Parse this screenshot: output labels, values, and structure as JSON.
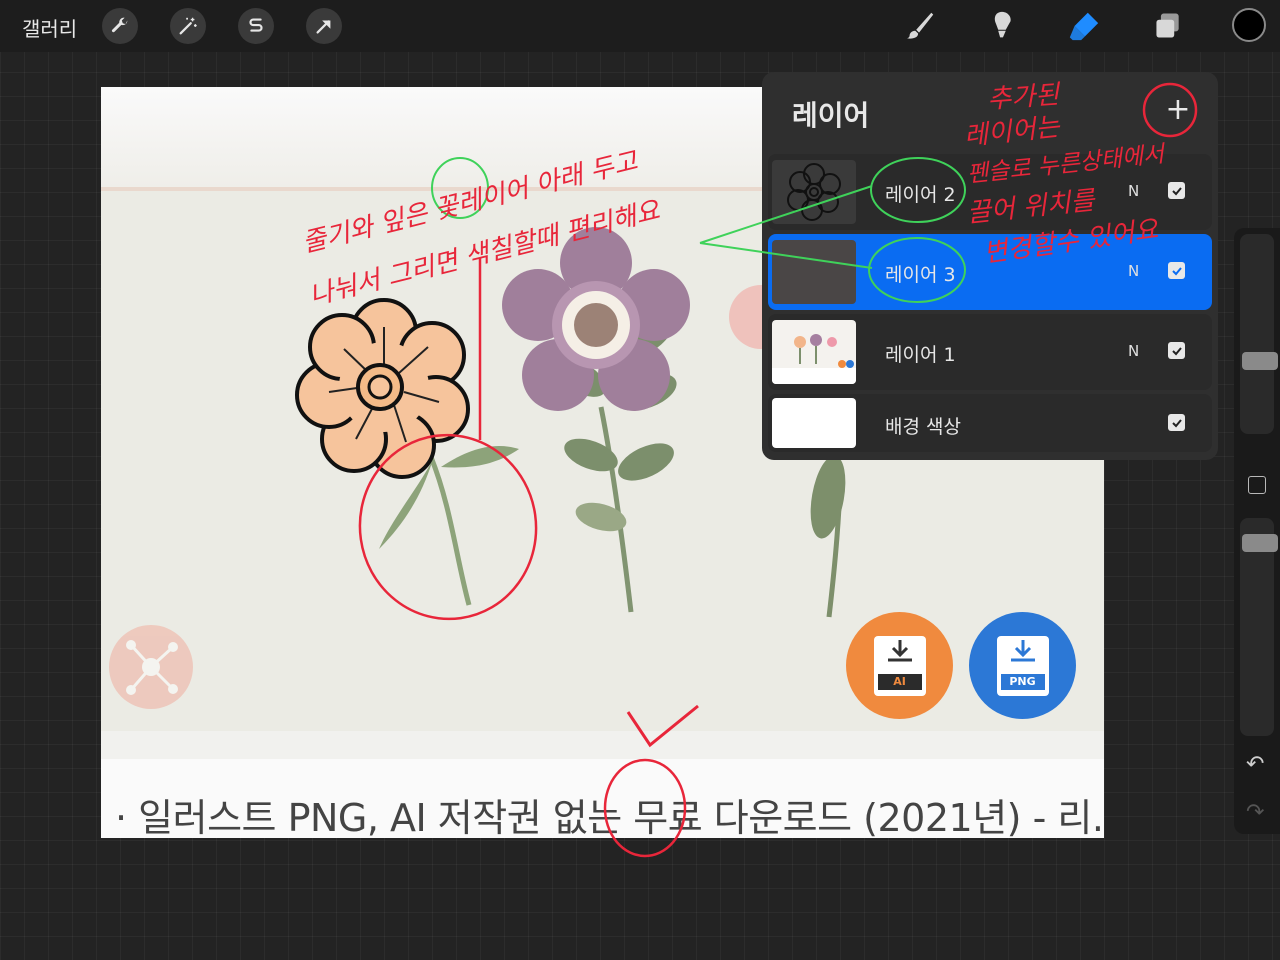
{
  "topbar": {
    "gallery_label": "갤러리",
    "left_tools": [
      "wrench-icon",
      "magic-wand-icon",
      "selection-icon",
      "transform-arrow-icon"
    ],
    "right_tools": [
      "brush-icon",
      "smudge-icon",
      "eraser-icon",
      "layers-icon"
    ],
    "active_tool": "eraser-icon",
    "current_color": "#000000"
  },
  "canvas": {
    "caption": "· 일러스트 PNG, AI 저작권 없는 무료 다운로드 (2021년) - 리...",
    "download_buttons": [
      {
        "label": "AI",
        "color": "#f08a3e"
      },
      {
        "label": "PNG",
        "color": "#2c78d6"
      }
    ]
  },
  "layers_panel": {
    "title": "레이어",
    "add_label": "+",
    "layers": [
      {
        "name": "레이어 2",
        "mode": "N",
        "visible": true,
        "selected": false
      },
      {
        "name": "레이어 3",
        "mode": "N",
        "visible": true,
        "selected": true
      },
      {
        "name": "레이어 1",
        "mode": "N",
        "visible": true,
        "selected": false
      },
      {
        "name": "배경 색상",
        "mode": "",
        "visible": true,
        "selected": false
      }
    ]
  },
  "sidebar": {
    "undo_label": "↶",
    "redo_label": "↷"
  },
  "annotations": {
    "note_left_line1": "줄기와 잎은 꽃레이어 아래 두고",
    "note_left_line2": "나눠서 그리면 색칠할때 편리해요",
    "note_right_line1": "추가된",
    "note_right_line2": "레이어는",
    "note_right_line3": "펜슬로 누른상태에서",
    "note_right_line4": "끌어 위치를",
    "note_right_line5": "변경할수 있어요"
  },
  "colors": {
    "accent_blue": "#0a6cf2",
    "annotation_red": "#e8263a",
    "annotation_green": "#3fd25a"
  }
}
